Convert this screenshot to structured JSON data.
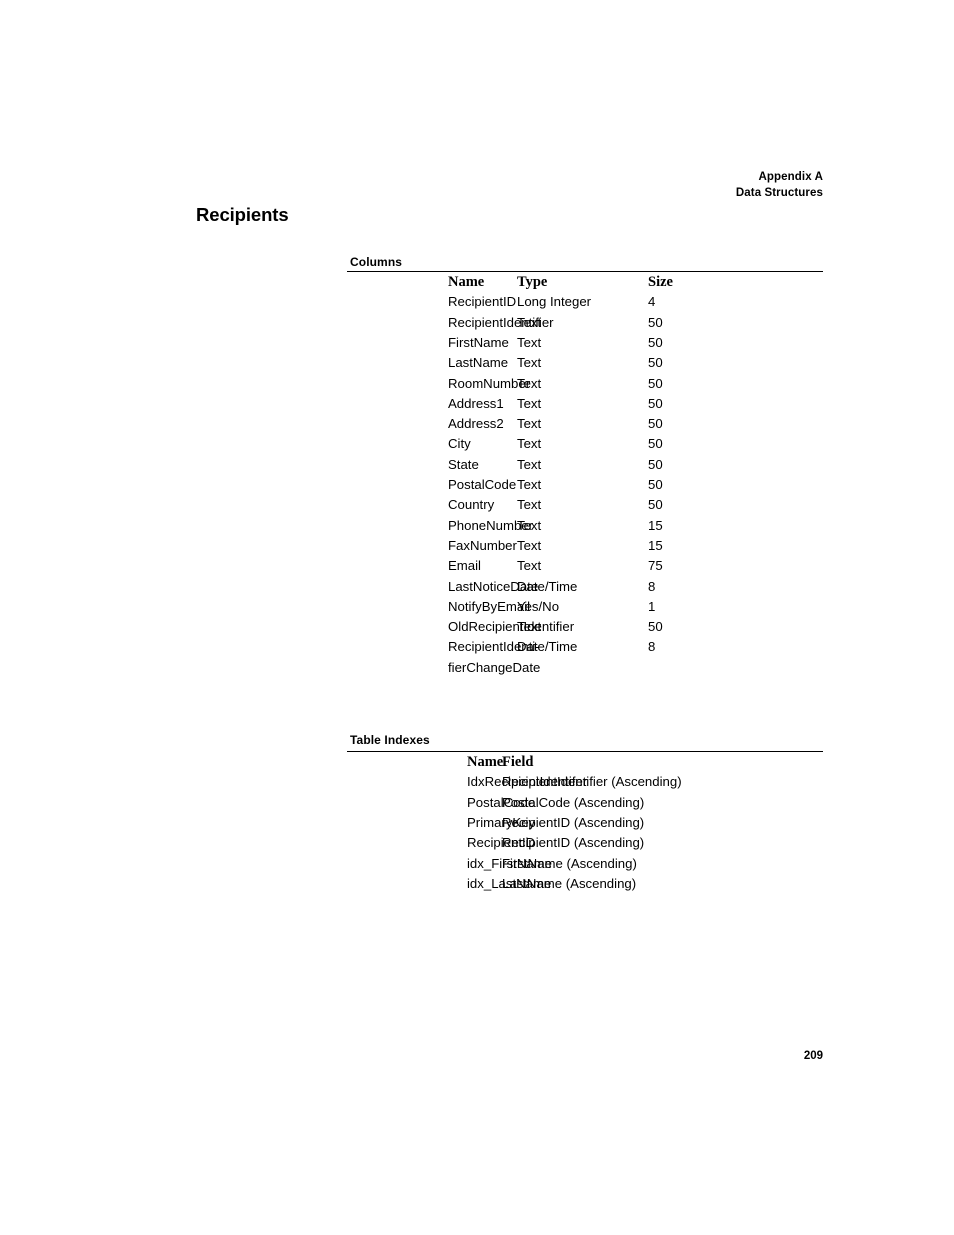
{
  "header": {
    "line1": "Appendix A",
    "line2": "Data Structures"
  },
  "title": "Recipients",
  "columns_section": {
    "label": "Columns",
    "headers": {
      "name": "Name",
      "type": "Type",
      "size": "Size"
    },
    "rows": [
      {
        "name": "RecipientID",
        "type": "Long Integer",
        "size": "4"
      },
      {
        "name": "RecipientIdentifier",
        "type": "Text",
        "size": "50"
      },
      {
        "name": "FirstName",
        "type": "Text",
        "size": "50"
      },
      {
        "name": "LastName",
        "type": "Text",
        "size": "50"
      },
      {
        "name": "RoomNumber",
        "type": "Text",
        "size": "50"
      },
      {
        "name": "Address1",
        "type": "Text",
        "size": "50"
      },
      {
        "name": "Address2",
        "type": "Text",
        "size": "50"
      },
      {
        "name": "City",
        "type": "Text",
        "size": "50"
      },
      {
        "name": "State",
        "type": "Text",
        "size": "50"
      },
      {
        "name": "PostalCode",
        "type": "Text",
        "size": "50"
      },
      {
        "name": "Country",
        "type": "Text",
        "size": "50"
      },
      {
        "name": "PhoneNumber",
        "type": "Text",
        "size": "15"
      },
      {
        "name": "FaxNumber",
        "type": "Text",
        "size": "15"
      },
      {
        "name": "Email",
        "type": "Text",
        "size": "75"
      },
      {
        "name": "LastNoticeDate",
        "type": "Date/Time",
        "size": "8"
      },
      {
        "name": "NotifyByEmail",
        "type": "Yes/No",
        "size": "1"
      },
      {
        "name": "OldRecipientIdentifier",
        "type": "Text",
        "size": "50"
      },
      {
        "name": "RecipientIdenti-\nfierChangeDate",
        "type": "Date/Time",
        "size": "8"
      }
    ]
  },
  "indexes_section": {
    "label": "Table Indexes",
    "headers": {
      "name": "Name",
      "field": "Field"
    },
    "rows": [
      {
        "name": "IdxRecipientIdentifer",
        "field": "RecipientIdentifier (Ascending)"
      },
      {
        "name": "PostalCode",
        "field": "PostalCode (Ascending)"
      },
      {
        "name": "PrimaryKey",
        "field": "RecipientID (Ascending)"
      },
      {
        "name": "RecipientID",
        "field": "RecipientID (Ascending)"
      },
      {
        "name": "idx_FirstName",
        "field": "FirstName (Ascending)"
      },
      {
        "name": "idx_LastName",
        "field": "LastName (Ascending)"
      }
    ]
  },
  "folio": "209"
}
